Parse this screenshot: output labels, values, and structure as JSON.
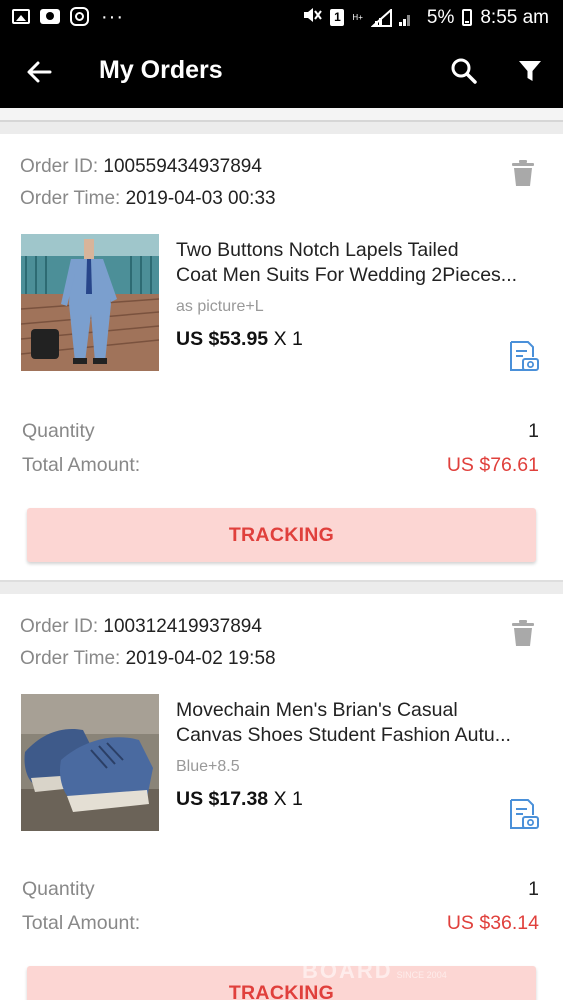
{
  "status_bar": {
    "more": "···",
    "sim_number": "1",
    "network_type": "H+",
    "battery": "5%",
    "time": "8:55 am"
  },
  "app_bar": {
    "title": "My Orders"
  },
  "labels": {
    "order_id": "Order ID: ",
    "order_time": "Order Time: ",
    "quantity": "Quantity",
    "total_amount": "Total Amount:",
    "tracking": "TRACKING"
  },
  "orders": [
    {
      "order_id": "100559434937894",
      "order_time": "2019-04-03 00:33",
      "title_line1": "Two Buttons Notch Lapels Tailed",
      "title_line2": "Coat Men Suits For Wedding 2Pieces...",
      "variant": "as picture+L",
      "price": "US $53.95",
      "qty_suffix": " X 1",
      "quantity": "1",
      "total": "US $76.61"
    },
    {
      "order_id": "100312419937894",
      "order_time": "2019-04-02 19:58",
      "title_line1": "Movechain Men's Brian's Casual",
      "title_line2": "Canvas Shoes Student Fashion Autu...",
      "variant": "Blue+8.5",
      "price": "US $17.38",
      "qty_suffix": " X 1",
      "quantity": "1",
      "total": "US $36.14"
    }
  ],
  "watermark": {
    "text": "BOARD",
    "sub": "SINCE 2004"
  },
  "colors": {
    "accent_red": "#e0403c",
    "tracking_bg": "#fcd6d3",
    "header_bg": "#000000"
  }
}
